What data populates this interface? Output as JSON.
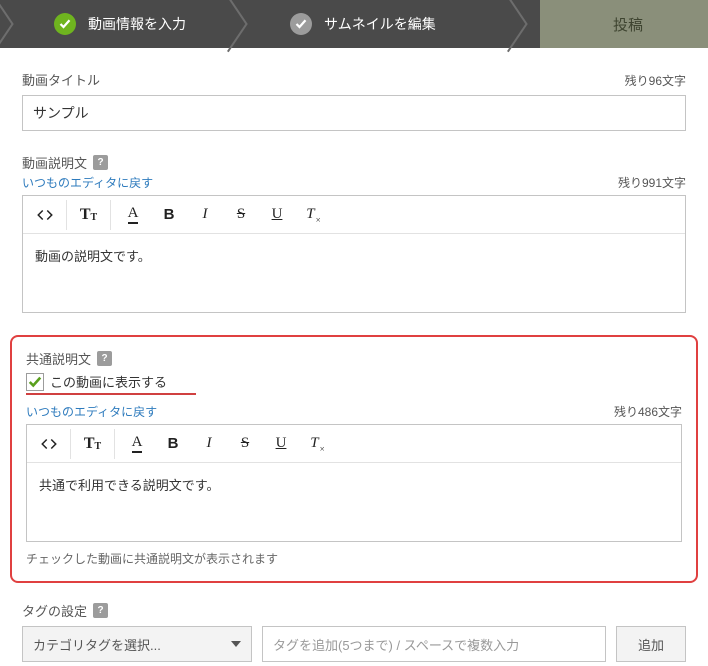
{
  "steps": {
    "step1_label": "動画情報を入力",
    "step2_label": "サムネイルを編集",
    "publish_label": "投稿"
  },
  "title_field": {
    "label": "動画タイトル",
    "remaining": "残り96文字",
    "value": "サンプル"
  },
  "description_field": {
    "label": "動画説明文",
    "help_badge": "?",
    "editor_link": "いつものエディタに戻す",
    "remaining": "残り991文字",
    "content": "動画の説明文です。"
  },
  "common_description": {
    "label": "共通説明文",
    "help_badge": "?",
    "checkbox_label": "この動画に表示する",
    "checkbox_checked": true,
    "editor_link": "いつものエディタに戻す",
    "remaining": "残り486文字",
    "content": "共通で利用できる説明文です。",
    "hint": "チェックした動画に共通説明文が表示されます"
  },
  "toolbar": {
    "code": "<>",
    "textsize_big": "T",
    "textsize_small": "T",
    "font": "A",
    "bold": "B",
    "italic": "I",
    "strike": "S",
    "underline": "U",
    "clear": "T",
    "clear_sub": "×"
  },
  "tags": {
    "label": "タグの設定",
    "help_badge": "?",
    "select_placeholder": "カテゴリタグを選択...",
    "input_placeholder": "タグを追加(5つまで) / スペースで複数入力",
    "add_button": "追加"
  }
}
